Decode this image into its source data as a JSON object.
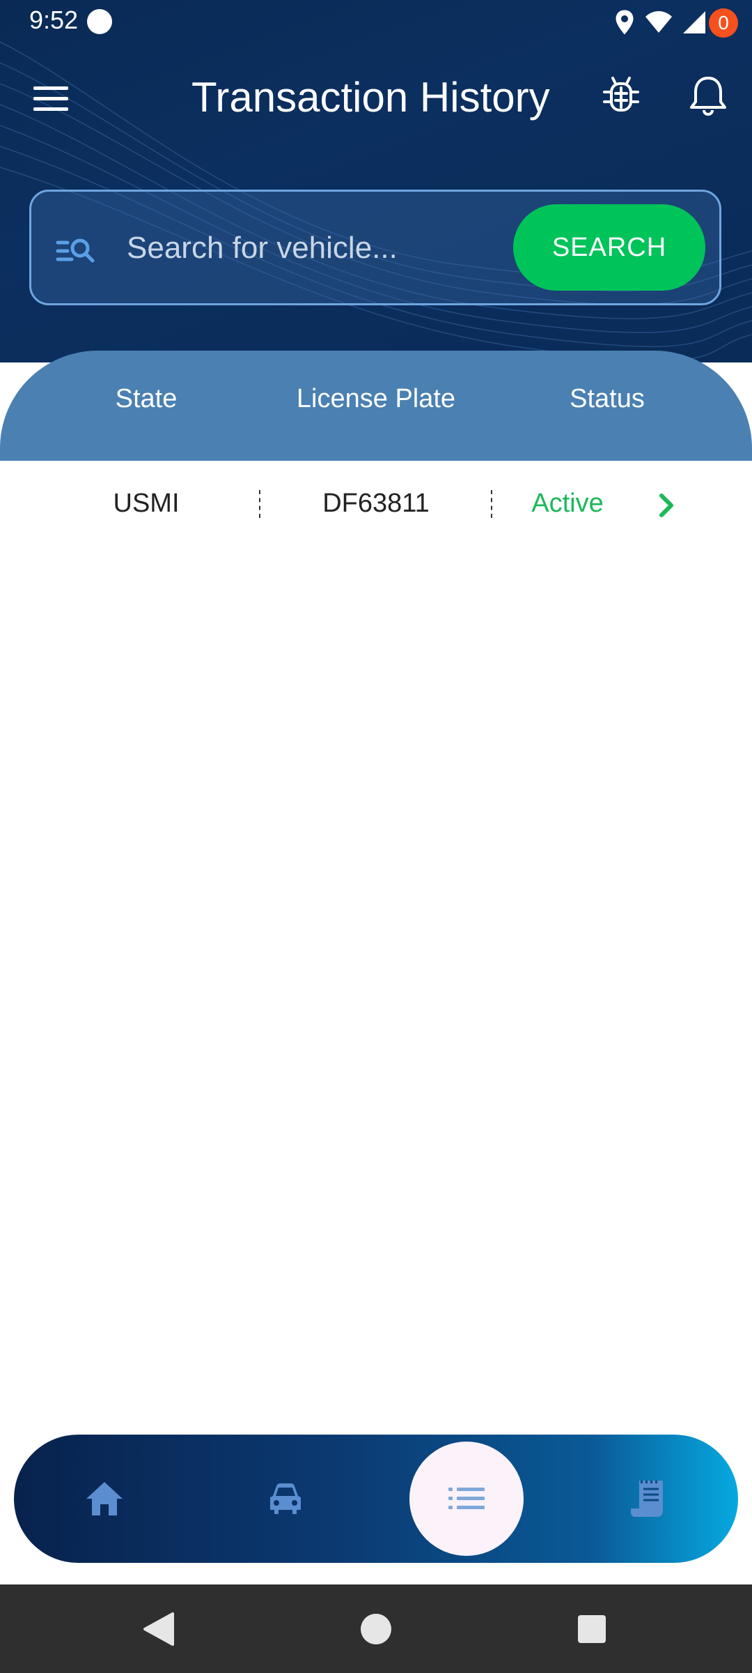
{
  "status_bar": {
    "time": "9:52"
  },
  "header": {
    "title": "Transaction History",
    "notification_count": "0"
  },
  "search": {
    "placeholder": "Search for vehicle...",
    "value": "",
    "button_label": "SEARCH"
  },
  "table": {
    "columns": [
      "State",
      "License Plate",
      "Status"
    ],
    "rows": [
      {
        "state": "USMI",
        "plate": "DF63811",
        "status": "Active"
      }
    ]
  },
  "bottom_nav": {
    "items": [
      "home-icon",
      "vehicle-icon",
      "list-icon",
      "receipt-icon"
    ],
    "active": "list-icon"
  },
  "colors": {
    "header_bg": "#0a2b58",
    "accent_green": "#00c35a",
    "table_header_bg": "#4a80b2",
    "status_active": "#1cb85a",
    "badge": "#f4511e"
  }
}
